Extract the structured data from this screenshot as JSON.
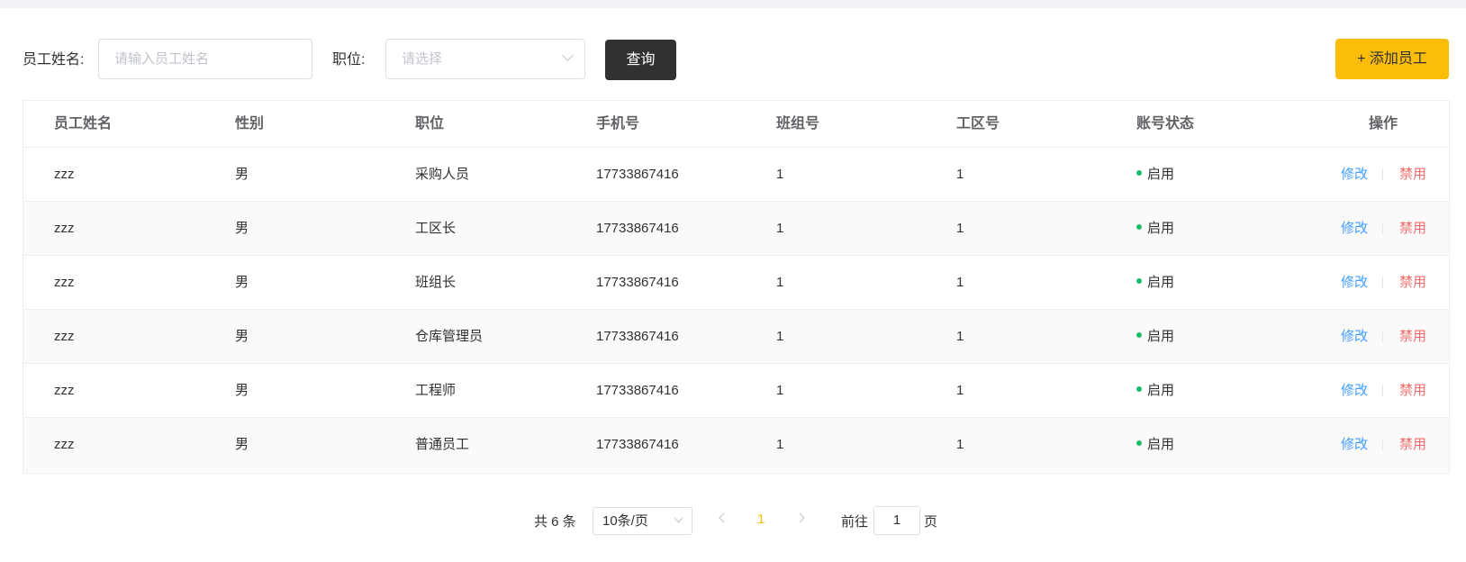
{
  "filters": {
    "name_label": "员工姓名:",
    "name_placeholder": "请输入员工姓名",
    "position_label": "职位:",
    "position_placeholder": "请选择",
    "query_button": "查询",
    "add_button": "+ 添加员工"
  },
  "table": {
    "columns": [
      "员工姓名",
      "性别",
      "职位",
      "手机号",
      "班组号",
      "工区号",
      "账号状态",
      "操作"
    ],
    "rows": [
      {
        "name": "zzz",
        "gender": "男",
        "position": "采购人员",
        "phone": "17733867416",
        "team": "1",
        "area": "1",
        "status": "启用",
        "edit": "修改",
        "disable": "禁用"
      },
      {
        "name": "zzz",
        "gender": "男",
        "position": "工区长",
        "phone": "17733867416",
        "team": "1",
        "area": "1",
        "status": "启用",
        "edit": "修改",
        "disable": "禁用"
      },
      {
        "name": "zzz",
        "gender": "男",
        "position": "班组长",
        "phone": "17733867416",
        "team": "1",
        "area": "1",
        "status": "启用",
        "edit": "修改",
        "disable": "禁用"
      },
      {
        "name": "zzz",
        "gender": "男",
        "position": "仓库管理员",
        "phone": "17733867416",
        "team": "1",
        "area": "1",
        "status": "启用",
        "edit": "修改",
        "disable": "禁用"
      },
      {
        "name": "zzz",
        "gender": "男",
        "position": "工程师",
        "phone": "17733867416",
        "team": "1",
        "area": "1",
        "status": "启用",
        "edit": "修改",
        "disable": "禁用"
      },
      {
        "name": "zzz",
        "gender": "男",
        "position": "普通员工",
        "phone": "17733867416",
        "team": "1",
        "area": "1",
        "status": "启用",
        "edit": "修改",
        "disable": "禁用"
      }
    ]
  },
  "pagination": {
    "total": "共 6 条",
    "page_size": "10条/页",
    "current_page": "1",
    "goto_label": "前往",
    "goto_value": "1",
    "goto_suffix": "页"
  },
  "colors": {
    "accent": "#fcbc0a",
    "dark_button": "#303133",
    "link_blue": "#409eff",
    "danger_red": "#f56c6c",
    "status_green": "#19be6b"
  }
}
